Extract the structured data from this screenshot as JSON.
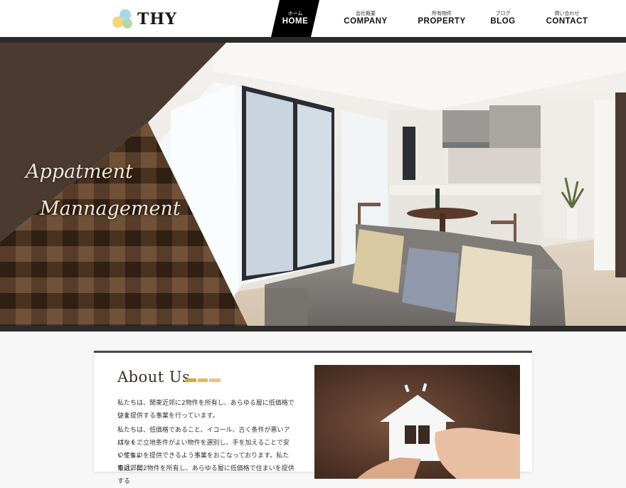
{
  "brand": {
    "name": "THY"
  },
  "nav": [
    {
      "jp": "ホーム",
      "en": "HOME",
      "active": true
    },
    {
      "jp": "会社概要",
      "en": "COMPANY",
      "active": false
    },
    {
      "jp": "所有物件",
      "en": "PROPERTY",
      "active": false
    },
    {
      "jp": "ブログ",
      "en": "BLOG",
      "active": false
    },
    {
      "jp": "問い合わせ",
      "en": "CONTACT",
      "active": false
    }
  ],
  "hero": {
    "line1": "Appatment",
    "line2": "Mannagement"
  },
  "about": {
    "title": "About Us",
    "paragraph1_line1": "私たちは、関東近郊に2物件を所有し、あらゆる層に低価格で住ま",
    "paragraph1_line2": "いを提供する事業を行っています。",
    "paragraph2_line1": "私たちは、低価格であること、イコール、古く条件が悪いアパートで",
    "paragraph2_line2": "はなく、立地条件がよい物件を選別し、手を加えることで安くてもよ",
    "paragraph2_line3": "い住まいを提供できるよう事業をおこなっております。私たちは、関",
    "paragraph2_line4": "東近郊に2物件を所有し、あらゆる層に低価格で住まいを提供する"
  },
  "colors": {
    "dark": "#2b2b2b",
    "brown": "#4a3a30",
    "accent_gold": "#d9a43a",
    "accent_light": "#ecc27a"
  },
  "icons": [
    "logo-circles-icon",
    "house-icon"
  ]
}
